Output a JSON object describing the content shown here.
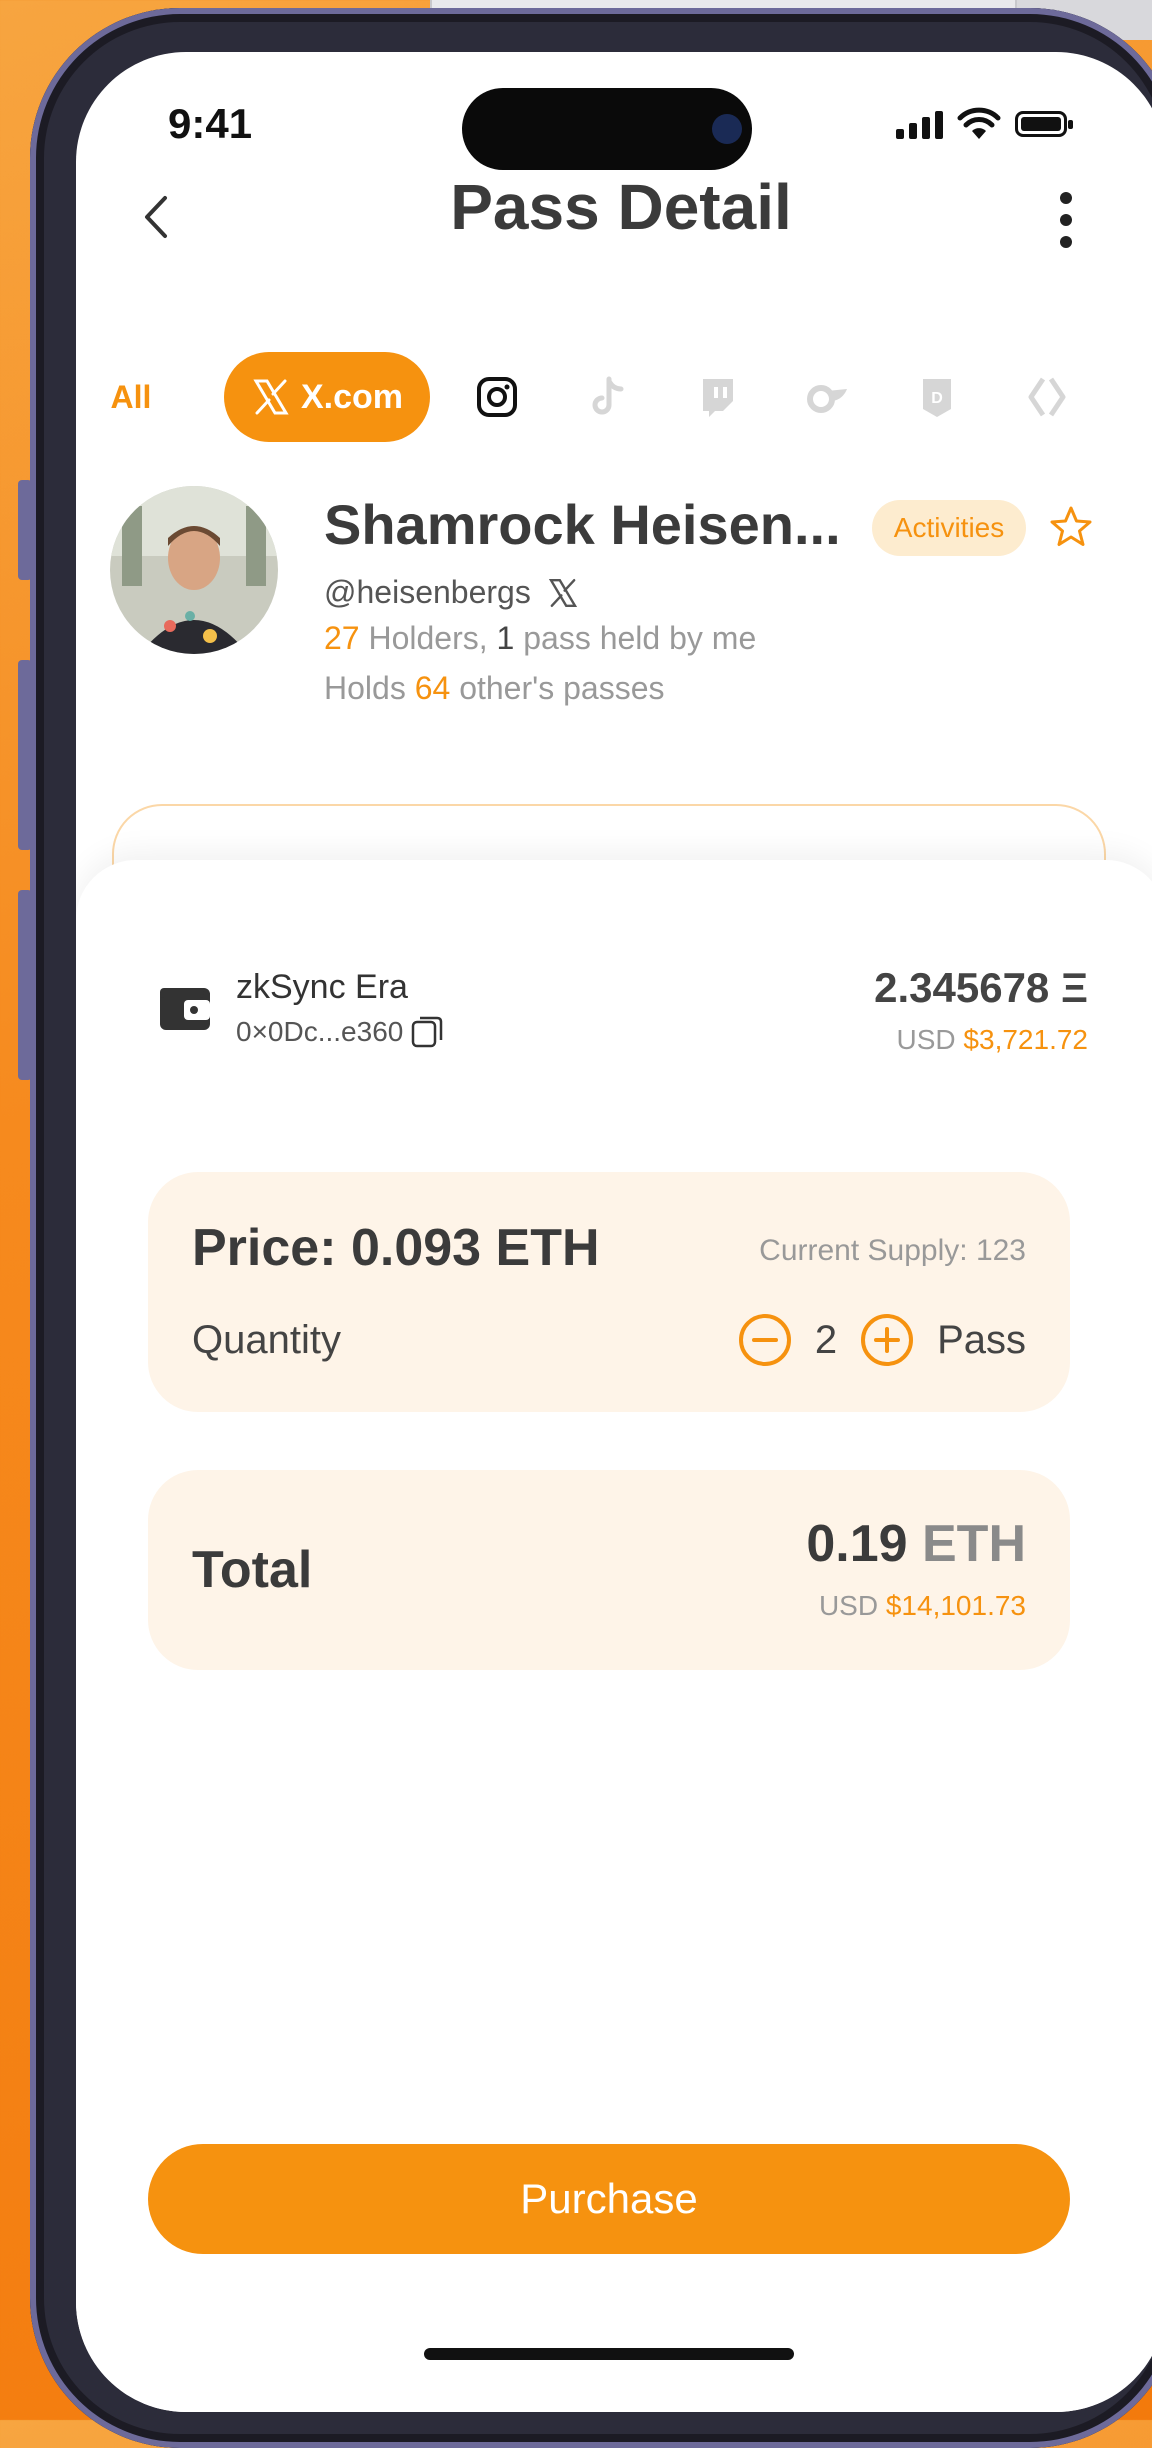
{
  "status_bar": {
    "time": "9:41"
  },
  "header": {
    "title": "Pass Detail"
  },
  "tabs": {
    "all_label": "All",
    "active_label": "X.com",
    "icons": [
      "instagram-icon",
      "tiktok-icon",
      "twitch-icon",
      "onlyfans-icon",
      "discord-icon",
      "web3-icon"
    ]
  },
  "profile": {
    "name": "Shamrock Heisen...",
    "badge": "Activities",
    "handle": "@heisenbergs",
    "holders_count": "27",
    "holders_text": " Holders, ",
    "held_count": "1",
    "held_text": " pass held by me",
    "holds_prefix": "Holds ",
    "holds_count": "64",
    "holds_suffix": " other's passes"
  },
  "wallet": {
    "network": "zkSync Era",
    "address": "0×0Dc...e360",
    "balance": "2.345678 Ξ",
    "usd_label": "USD ",
    "usd_value": "$3,721.72"
  },
  "price_card": {
    "price": "Price: 0.093 ETH",
    "supply": "Current Supply: 123",
    "quantity_label": "Quantity",
    "quantity": "2",
    "unit": "Pass"
  },
  "total_card": {
    "label": "Total",
    "amount": "0.19",
    "currency": " ETH",
    "usd_label": "USD ",
    "usd_value": "$14,101.73"
  },
  "actions": {
    "purchase": "Purchase"
  },
  "colors": {
    "accent": "#f6920f",
    "card_bg": "#fef4e8",
    "text": "#3b3b3b"
  }
}
